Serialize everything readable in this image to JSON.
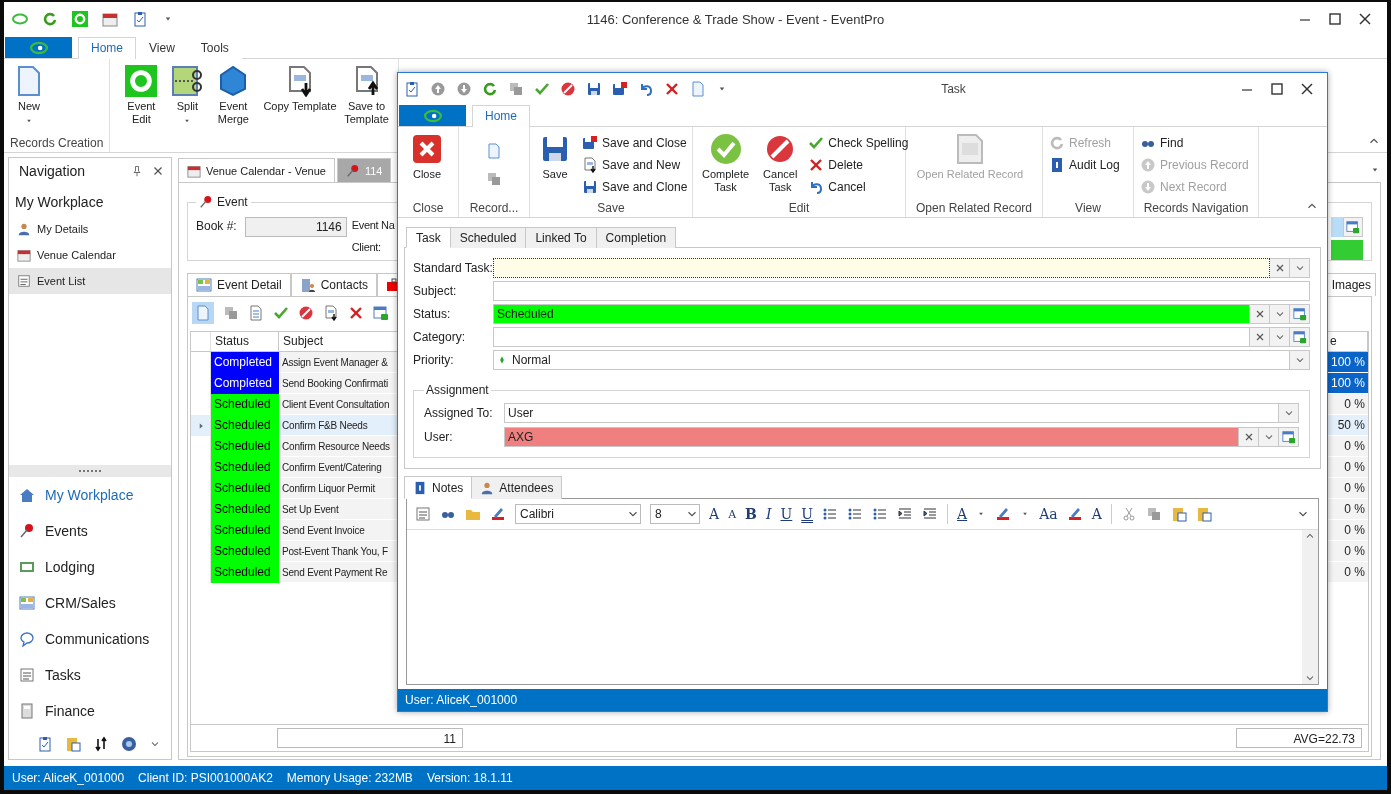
{
  "window": {
    "title": "1146: Conference & Trade Show - Event - EventPro"
  },
  "ribbon_tabs": [
    {
      "label": "Home",
      "selected": true
    },
    {
      "label": "View",
      "selected": false
    },
    {
      "label": "Tools",
      "selected": false
    }
  ],
  "ribbon_groups": [
    {
      "label": "Records Creation",
      "buttons": [
        {
          "label": "New",
          "dropdown": true
        }
      ]
    },
    {
      "buttons": [
        {
          "label": "Event Edit",
          "dropdown": false
        },
        {
          "label": "Split",
          "dropdown": true
        },
        {
          "label": "Event Merge",
          "dropdown": false
        },
        {
          "label": "Copy Template",
          "dropdown": false
        },
        {
          "label": "Save to Template",
          "dropdown": false
        }
      ]
    }
  ],
  "navigation": {
    "title": "Navigation",
    "section": "My Workplace",
    "items": [
      {
        "label": "My Details",
        "selected": false
      },
      {
        "label": "Venue Calendar",
        "selected": false
      },
      {
        "label": "Event List",
        "selected": true
      }
    ],
    "modules": [
      {
        "label": "My Workplace",
        "selected": true
      },
      {
        "label": "Events",
        "selected": false
      },
      {
        "label": "Lodging",
        "selected": false
      },
      {
        "label": "CRM/Sales",
        "selected": false
      },
      {
        "label": "Communications",
        "selected": false
      },
      {
        "label": "Tasks",
        "selected": false
      },
      {
        "label": "Finance",
        "selected": false
      }
    ]
  },
  "document_tabs": [
    {
      "label": "Venue Calendar - Venue",
      "selected": false
    },
    {
      "label": "114",
      "selected": true
    }
  ],
  "event": {
    "group_title": "Event",
    "book_label": "Book #:",
    "book_value": "1146",
    "event_name_label": "Event Na",
    "client_label": "Client:"
  },
  "detail_tabs": [
    {
      "label": "Event Detail"
    },
    {
      "label": "Contacts"
    }
  ],
  "images_tab": {
    "label": "Images"
  },
  "grid": {
    "columns": [
      "Status",
      "Subject",
      "e"
    ],
    "rows": [
      {
        "status": "Completed",
        "color": "#0000ff",
        "subject": "Assign Event Manager &",
        "percent": "100 %",
        "highlighted": true,
        "current": false
      },
      {
        "status": "Completed",
        "color": "#0000ff",
        "subject": "Send Booking Confirmati",
        "percent": "100 %",
        "highlighted": true,
        "current": false
      },
      {
        "status": "Scheduled",
        "color": "#00ff00",
        "subject": "Client Event Consultation",
        "percent": "0 %",
        "highlighted": false,
        "current": false
      },
      {
        "status": "Scheduled",
        "color": "#00ff00",
        "subject": "Confirm F&B Needs",
        "percent": "50 %",
        "highlighted": false,
        "current": true
      },
      {
        "status": "Scheduled",
        "color": "#00ff00",
        "subject": "Confirm Resource Needs",
        "percent": "0 %",
        "highlighted": false,
        "current": false
      },
      {
        "status": "Scheduled",
        "color": "#00ff00",
        "subject": "Confirm Event/Catering",
        "percent": "0 %",
        "highlighted": false,
        "current": false
      },
      {
        "status": "Scheduled",
        "color": "#00ff00",
        "subject": "Confirm Liquor Permit",
        "percent": "0 %",
        "highlighted": false,
        "current": false
      },
      {
        "status": "Scheduled",
        "color": "#00ff00",
        "subject": "Set Up Event",
        "percent": "0 %",
        "highlighted": false,
        "current": false
      },
      {
        "status": "Scheduled",
        "color": "#00ff00",
        "subject": "Send Event Invoice",
        "percent": "0 %",
        "highlighted": false,
        "current": false
      },
      {
        "status": "Scheduled",
        "color": "#00ff00",
        "subject": "Post-Event Thank You, F",
        "percent": "0 %",
        "highlighted": false,
        "current": false
      },
      {
        "status": "Scheduled",
        "color": "#00ff00",
        "subject": "Send Event Payment Re",
        "percent": "0 %",
        "highlighted": false,
        "current": false
      }
    ],
    "count": "11",
    "average": "AVG=22.73"
  },
  "status_bar": [
    "User: AliceK_001000",
    "Client ID: PSI001000AK2",
    "Memory Usage: 232MB",
    "Version: 18.1.11"
  ],
  "task_dialog": {
    "title": "Task",
    "ribbon_tab": {
      "label": "Home",
      "selected": true
    },
    "groups": [
      {
        "label": "Close",
        "large": [
          {
            "label": "Close",
            "disabled": false
          }
        ]
      },
      {
        "label": "Record..."
      },
      {
        "label": "Save",
        "large": [
          {
            "label": "Save",
            "disabled": false
          }
        ],
        "small": [
          {
            "label": "Save and Close",
            "disabled": false
          },
          {
            "label": "Save and New",
            "disabled": false
          },
          {
            "label": "Save and Clone",
            "disabled": false
          }
        ]
      },
      {
        "label": "Edit",
        "large": [
          {
            "label": "Complete Task",
            "disabled": false
          },
          {
            "label": "Cancel Task",
            "disabled": false
          }
        ],
        "small": [
          {
            "label": "Check Spelling",
            "disabled": false
          },
          {
            "label": "Delete",
            "disabled": false
          },
          {
            "label": "Cancel",
            "disabled": false
          }
        ]
      },
      {
        "label": "Open Related Record",
        "large": [
          {
            "label": "Open Related Record",
            "disabled": true
          }
        ]
      },
      {
        "label": "View",
        "small": [
          {
            "label": "Refresh",
            "disabled": true
          },
          {
            "label": "Audit Log",
            "disabled": false
          }
        ]
      },
      {
        "label": "Records Navigation",
        "small": [
          {
            "label": "Find",
            "disabled": false
          },
          {
            "label": "Previous Record",
            "disabled": true
          },
          {
            "label": "Next Record",
            "disabled": true
          }
        ]
      }
    ],
    "tabs": [
      {
        "label": "Task",
        "selected": true
      },
      {
        "label": "Scheduled",
        "selected": false
      },
      {
        "label": "Linked To",
        "selected": false
      },
      {
        "label": "Completion",
        "selected": false
      }
    ],
    "fields": [
      {
        "label": "Standard Task:",
        "kind": "clearable",
        "focused": true
      },
      {
        "label": "Subject:",
        "kind": "text",
        "focused": false
      },
      {
        "label": "Status:",
        "kind": "lookup",
        "value": "Scheduled",
        "color": "#00ff00",
        "focused": false
      },
      {
        "label": "Category:",
        "kind": "lookup",
        "focused": false
      },
      {
        "label": "Priority:",
        "kind": "dropdown",
        "value": "Normal",
        "focused": false
      }
    ],
    "assignment": {
      "title": "Assignment",
      "fields": [
        {
          "label": "Assigned To:",
          "kind": "dropdown",
          "value": "User",
          "focused": false
        },
        {
          "label": "User:",
          "kind": "lookup",
          "value": "AXG",
          "color": "#f08080",
          "focused": false
        }
      ]
    },
    "notes_tabs": [
      {
        "label": "Notes",
        "selected": true
      },
      {
        "label": "Attendees",
        "selected": false
      }
    ],
    "editor": {
      "font": "Calibri",
      "size": "8",
      "format_glyphs": [
        "A",
        "A",
        "B",
        "I",
        "U",
        "U"
      ],
      "style_glyphs": [
        "A",
        "Aa",
        "A"
      ]
    },
    "status": "User: AliceK_001000"
  }
}
